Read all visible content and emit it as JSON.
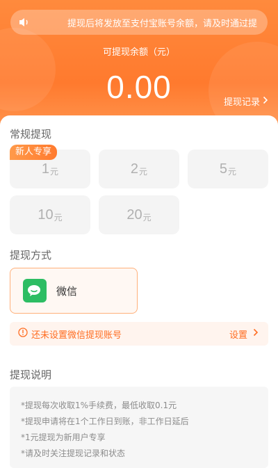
{
  "notice": {
    "text": "提现后将发放至支付宝账号余额，请及时通过提"
  },
  "balance": {
    "label": "可提现余额（元）",
    "amount": "0.00"
  },
  "records_link": "提现记录",
  "regular": {
    "title": "常规提现",
    "badge": "新人专享",
    "unit": "元",
    "amounts": [
      "1",
      "2",
      "5",
      "10",
      "20"
    ]
  },
  "method": {
    "title": "提现方式",
    "name": "微信"
  },
  "warning": {
    "text": "还未设置微信提现账号",
    "action": "设置"
  },
  "instructions": {
    "title": "提现说明",
    "lines": [
      "*提现每次收取1%手续费，最低收取0.1元",
      "*提现申请将在1个工作日到账，非工作日延后",
      "*1元提现为新用户专享",
      "*请及时关注提现记录和状态"
    ]
  },
  "colors": {
    "accent": "#ff7a2e",
    "wechat": "#2dbd63",
    "warning_text": "#ff6d22"
  }
}
